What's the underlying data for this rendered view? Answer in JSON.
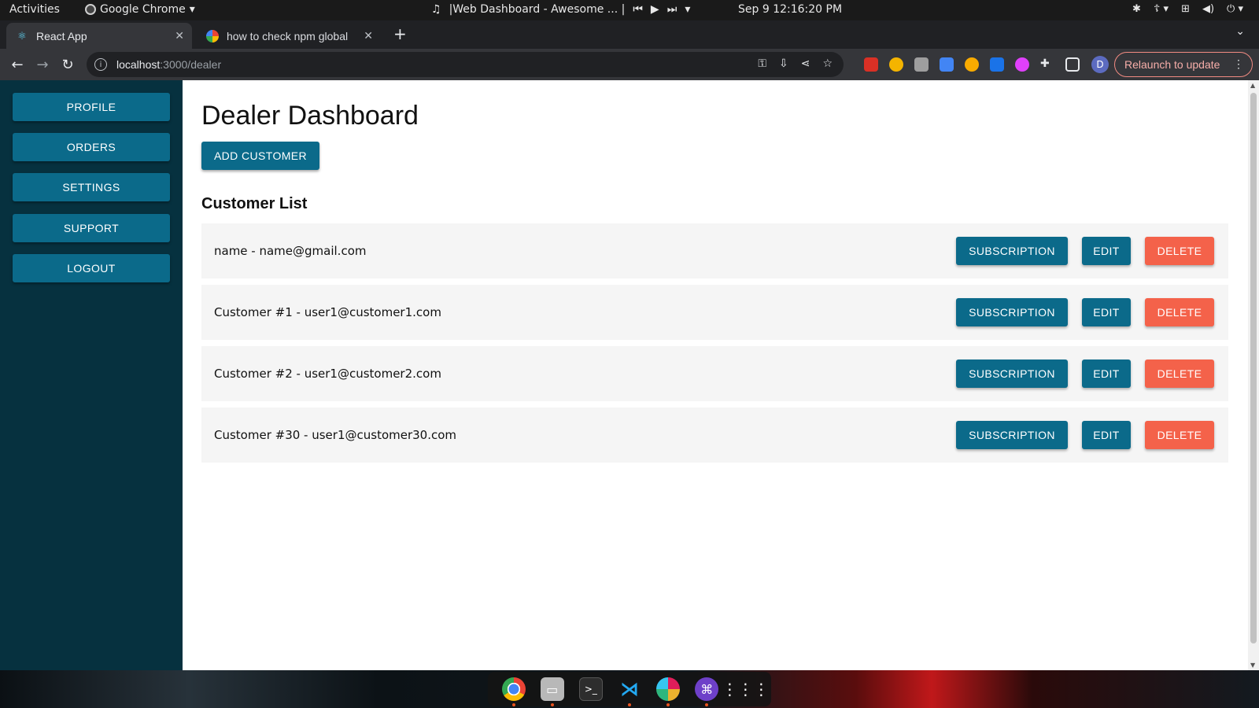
{
  "system_bar": {
    "activities": "Activities",
    "app_name": "Google Chrome",
    "media_title": "|Web Dashboard - Awesome ... |",
    "clock": "Sep 9  12:16:20 PM"
  },
  "browser": {
    "tabs": [
      {
        "title": "React App",
        "icon": "react-icon",
        "active": true
      },
      {
        "title": "how to check npm global",
        "icon": "google-icon",
        "active": false
      }
    ],
    "url_host": "localhost",
    "url_path": ":3000/dealer",
    "relaunch_label": "Relaunch to update",
    "profile_initial": "D"
  },
  "sidebar": {
    "items": [
      {
        "label": "PROFILE"
      },
      {
        "label": "ORDERS"
      },
      {
        "label": "SETTINGS"
      },
      {
        "label": "SUPPORT"
      },
      {
        "label": "LOGOUT"
      }
    ]
  },
  "main": {
    "title": "Dealer Dashboard",
    "add_customer_label": "ADD CUSTOMER",
    "list_title": "Customer List",
    "customers": [
      {
        "text": "name - name@gmail.com"
      },
      {
        "text": "Customer #1 - user1@customer1.com"
      },
      {
        "text": "Customer #2 - user1@customer2.com"
      },
      {
        "text": "Customer #30 - user1@customer30.com"
      }
    ],
    "actions": {
      "subscription_label": "SUBSCRIPTION",
      "edit_label": "EDIT",
      "delete_label": "DELETE"
    }
  },
  "colors": {
    "sidebar_bg": "#06313f",
    "primary_button": "#0b6a8a",
    "delete_button": "#f4624a",
    "row_bg": "#f5f5f5"
  }
}
